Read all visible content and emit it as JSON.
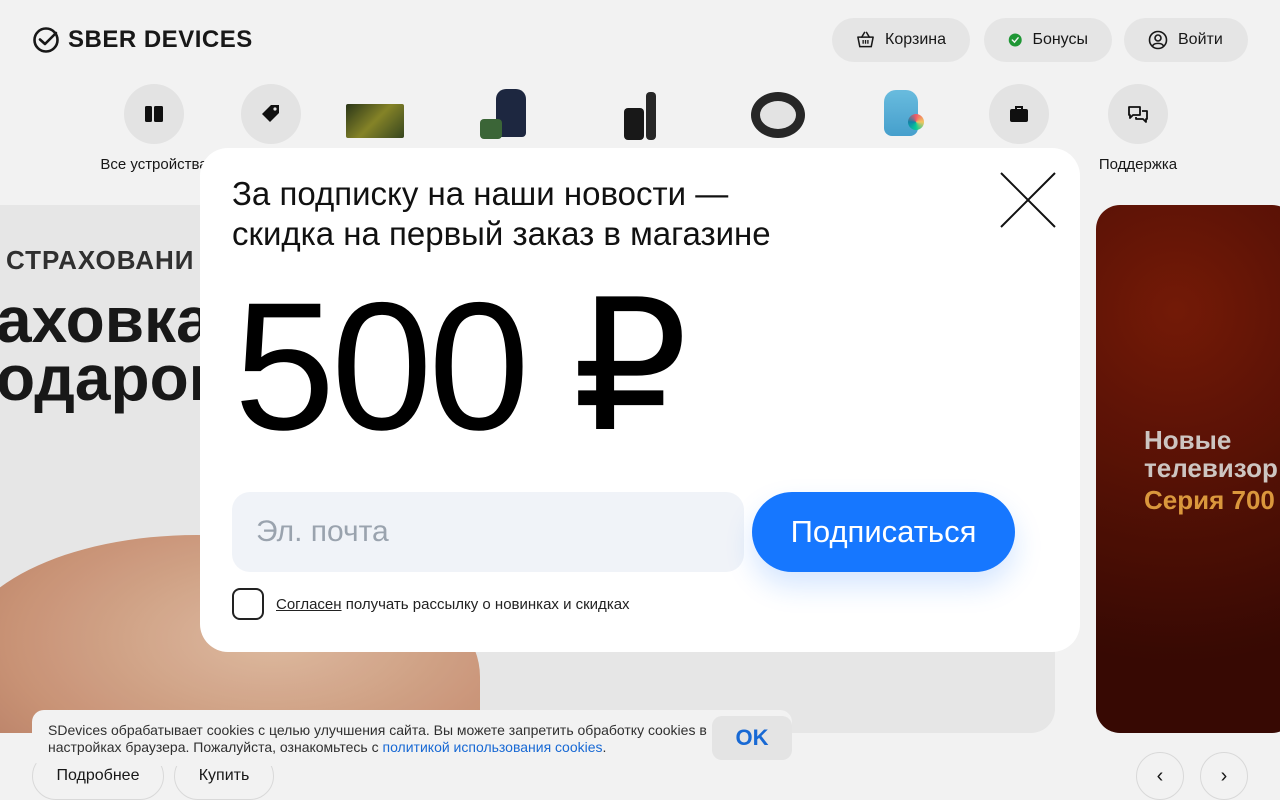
{
  "header": {
    "logo_text": "SBER DEVICES",
    "cart_label": "Корзина",
    "bonus_label": "Бонусы",
    "login_label": "Войти"
  },
  "categories": {
    "all_devices": "Все устройства",
    "support": "Поддержка"
  },
  "banner_left": {
    "tag": "СТРАХОВАНИ",
    "line1": "аховка",
    "line2": "одарок"
  },
  "banner_right": {
    "line1": "Новые",
    "line2": "телевизор",
    "line3": "Серия 700"
  },
  "bottom": {
    "more_label": "Подробнее",
    "buy_label": "Купить",
    "prev_icon": "‹",
    "next_icon": "›"
  },
  "cookie": {
    "text": "SDevices обрабатывает cookies с целью улучшения сайта. Вы можете запретить обработку cookies в настройках браузера. Пожалуйста, ознакомьтесь с ",
    "link": "политикой использования cookies",
    "text_end": ".",
    "ok_label": "OK"
  },
  "modal": {
    "title_line1": "За подписку на наши новости —",
    "title_line2": "скидка на первый заказ в магазине",
    "amount": "500 ₽",
    "email_placeholder": "Эл. почта",
    "subscribe_label": "Подписаться",
    "agree_link": "Согласен",
    "agree_text": "получать рассылку о новинках и скидках"
  },
  "colors": {
    "accent": "#1677ff",
    "bonus_green": "#21a038",
    "cookie_link": "#1a6fe0"
  }
}
